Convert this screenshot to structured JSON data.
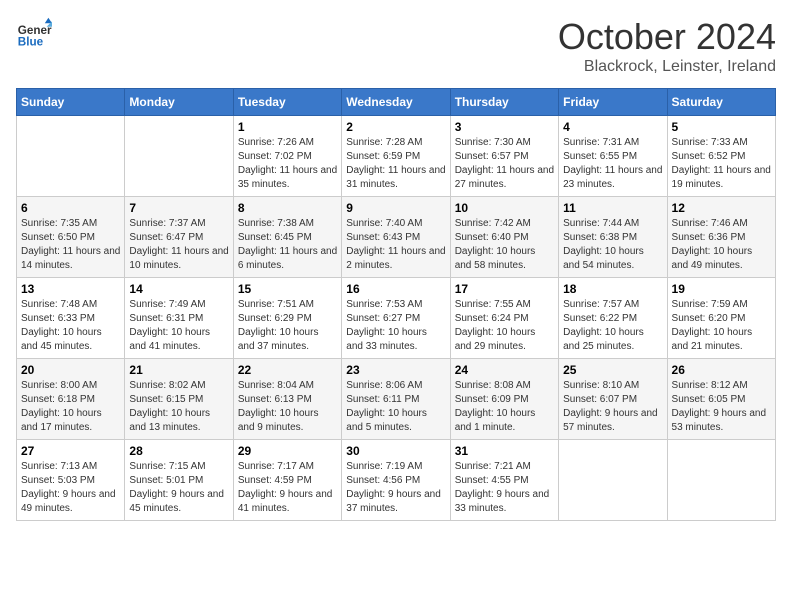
{
  "header": {
    "logo_line1": "General",
    "logo_line2": "Blue",
    "month": "October 2024",
    "location": "Blackrock, Leinster, Ireland"
  },
  "weekdays": [
    "Sunday",
    "Monday",
    "Tuesday",
    "Wednesday",
    "Thursday",
    "Friday",
    "Saturday"
  ],
  "weeks": [
    [
      {
        "day": "",
        "info": ""
      },
      {
        "day": "",
        "info": ""
      },
      {
        "day": "1",
        "info": "Sunrise: 7:26 AM\nSunset: 7:02 PM\nDaylight: 11 hours and 35 minutes."
      },
      {
        "day": "2",
        "info": "Sunrise: 7:28 AM\nSunset: 6:59 PM\nDaylight: 11 hours and 31 minutes."
      },
      {
        "day": "3",
        "info": "Sunrise: 7:30 AM\nSunset: 6:57 PM\nDaylight: 11 hours and 27 minutes."
      },
      {
        "day": "4",
        "info": "Sunrise: 7:31 AM\nSunset: 6:55 PM\nDaylight: 11 hours and 23 minutes."
      },
      {
        "day": "5",
        "info": "Sunrise: 7:33 AM\nSunset: 6:52 PM\nDaylight: 11 hours and 19 minutes."
      }
    ],
    [
      {
        "day": "6",
        "info": "Sunrise: 7:35 AM\nSunset: 6:50 PM\nDaylight: 11 hours and 14 minutes."
      },
      {
        "day": "7",
        "info": "Sunrise: 7:37 AM\nSunset: 6:47 PM\nDaylight: 11 hours and 10 minutes."
      },
      {
        "day": "8",
        "info": "Sunrise: 7:38 AM\nSunset: 6:45 PM\nDaylight: 11 hours and 6 minutes."
      },
      {
        "day": "9",
        "info": "Sunrise: 7:40 AM\nSunset: 6:43 PM\nDaylight: 11 hours and 2 minutes."
      },
      {
        "day": "10",
        "info": "Sunrise: 7:42 AM\nSunset: 6:40 PM\nDaylight: 10 hours and 58 minutes."
      },
      {
        "day": "11",
        "info": "Sunrise: 7:44 AM\nSunset: 6:38 PM\nDaylight: 10 hours and 54 minutes."
      },
      {
        "day": "12",
        "info": "Sunrise: 7:46 AM\nSunset: 6:36 PM\nDaylight: 10 hours and 49 minutes."
      }
    ],
    [
      {
        "day": "13",
        "info": "Sunrise: 7:48 AM\nSunset: 6:33 PM\nDaylight: 10 hours and 45 minutes."
      },
      {
        "day": "14",
        "info": "Sunrise: 7:49 AM\nSunset: 6:31 PM\nDaylight: 10 hours and 41 minutes."
      },
      {
        "day": "15",
        "info": "Sunrise: 7:51 AM\nSunset: 6:29 PM\nDaylight: 10 hours and 37 minutes."
      },
      {
        "day": "16",
        "info": "Sunrise: 7:53 AM\nSunset: 6:27 PM\nDaylight: 10 hours and 33 minutes."
      },
      {
        "day": "17",
        "info": "Sunrise: 7:55 AM\nSunset: 6:24 PM\nDaylight: 10 hours and 29 minutes."
      },
      {
        "day": "18",
        "info": "Sunrise: 7:57 AM\nSunset: 6:22 PM\nDaylight: 10 hours and 25 minutes."
      },
      {
        "day": "19",
        "info": "Sunrise: 7:59 AM\nSunset: 6:20 PM\nDaylight: 10 hours and 21 minutes."
      }
    ],
    [
      {
        "day": "20",
        "info": "Sunrise: 8:00 AM\nSunset: 6:18 PM\nDaylight: 10 hours and 17 minutes."
      },
      {
        "day": "21",
        "info": "Sunrise: 8:02 AM\nSunset: 6:15 PM\nDaylight: 10 hours and 13 minutes."
      },
      {
        "day": "22",
        "info": "Sunrise: 8:04 AM\nSunset: 6:13 PM\nDaylight: 10 hours and 9 minutes."
      },
      {
        "day": "23",
        "info": "Sunrise: 8:06 AM\nSunset: 6:11 PM\nDaylight: 10 hours and 5 minutes."
      },
      {
        "day": "24",
        "info": "Sunrise: 8:08 AM\nSunset: 6:09 PM\nDaylight: 10 hours and 1 minute."
      },
      {
        "day": "25",
        "info": "Sunrise: 8:10 AM\nSunset: 6:07 PM\nDaylight: 9 hours and 57 minutes."
      },
      {
        "day": "26",
        "info": "Sunrise: 8:12 AM\nSunset: 6:05 PM\nDaylight: 9 hours and 53 minutes."
      }
    ],
    [
      {
        "day": "27",
        "info": "Sunrise: 7:13 AM\nSunset: 5:03 PM\nDaylight: 9 hours and 49 minutes."
      },
      {
        "day": "28",
        "info": "Sunrise: 7:15 AM\nSunset: 5:01 PM\nDaylight: 9 hours and 45 minutes."
      },
      {
        "day": "29",
        "info": "Sunrise: 7:17 AM\nSunset: 4:59 PM\nDaylight: 9 hours and 41 minutes."
      },
      {
        "day": "30",
        "info": "Sunrise: 7:19 AM\nSunset: 4:56 PM\nDaylight: 9 hours and 37 minutes."
      },
      {
        "day": "31",
        "info": "Sunrise: 7:21 AM\nSunset: 4:55 PM\nDaylight: 9 hours and 33 minutes."
      },
      {
        "day": "",
        "info": ""
      },
      {
        "day": "",
        "info": ""
      }
    ]
  ]
}
